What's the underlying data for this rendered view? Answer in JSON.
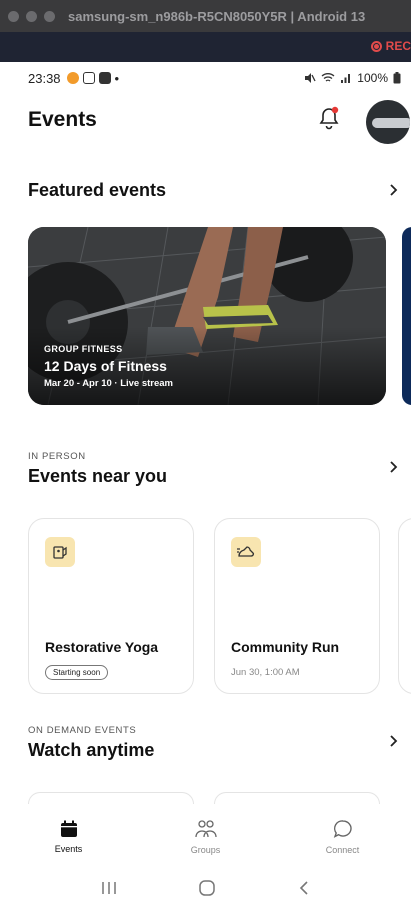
{
  "window": {
    "title": "samsung-sm_n986b-R5CN8050Y5R | Android 13",
    "rec_label": "REC"
  },
  "status": {
    "time": "23:38",
    "battery": "100%",
    "dot": "•"
  },
  "header": {
    "title": "Events"
  },
  "featured": {
    "title": "Featured events",
    "card": {
      "overline": "GROUP FITNESS",
      "title": "12 Days of Fitness",
      "subtitle": "Mar 20 - Apr 10 · Live stream"
    }
  },
  "near": {
    "overline": "IN PERSON",
    "title": "Events near you",
    "cards": [
      {
        "title": "Restorative Yoga",
        "badge": "Starting soon"
      },
      {
        "title": "Community Run",
        "subtitle": "Jun 30, 1:00 AM"
      }
    ]
  },
  "ondemand": {
    "overline": "ON DEMAND EVENTS",
    "title": "Watch anytime"
  },
  "tabs": [
    {
      "label": "Events",
      "icon": "calendar-icon",
      "active": true
    },
    {
      "label": "Groups",
      "icon": "groups-icon",
      "active": false
    },
    {
      "label": "Connect",
      "icon": "chat-bubble-icon",
      "active": false
    }
  ],
  "colors": {
    "accent_tile": "#f8e5b0",
    "notification_dot": "#e53935",
    "rec": "#e14b4b"
  }
}
